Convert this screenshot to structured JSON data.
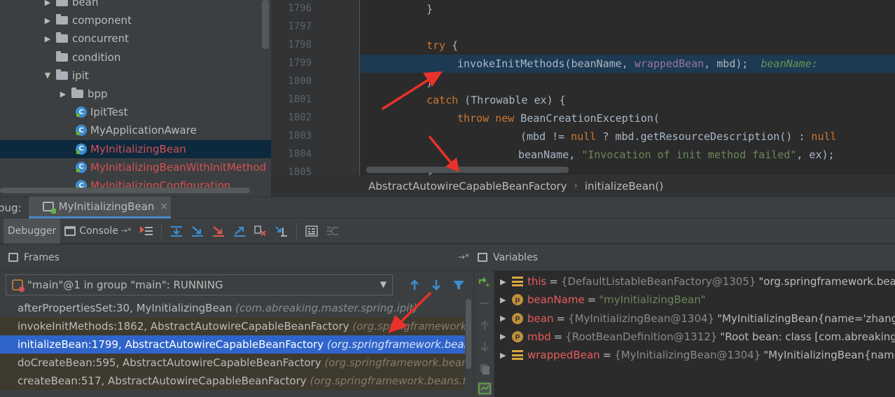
{
  "project_tree": {
    "items": [
      {
        "label": "bean",
        "kind": "folder",
        "arrow": "▶",
        "indent": 66,
        "error": false
      },
      {
        "label": "component",
        "kind": "folder",
        "arrow": "▶",
        "indent": 66,
        "error": false
      },
      {
        "label": "concurrent",
        "kind": "folder",
        "arrow": "▶",
        "indent": 66,
        "error": false
      },
      {
        "label": "condition",
        "kind": "folder",
        "arrow": "",
        "indent": 66,
        "error": false
      },
      {
        "label": "ipit",
        "kind": "folder",
        "arrow": "▼",
        "indent": 66,
        "error": false
      },
      {
        "label": "bpp",
        "kind": "folder",
        "arrow": "▶",
        "indent": 88,
        "error": false
      },
      {
        "label": "IpitTest",
        "kind": "class",
        "arrow": "",
        "indent": 98,
        "error": false
      },
      {
        "label": "MyApplicationAware",
        "kind": "class",
        "arrow": "",
        "indent": 98,
        "error": false
      },
      {
        "label": "MyInitializingBean",
        "kind": "class",
        "arrow": "",
        "indent": 98,
        "error": true,
        "selected": true
      },
      {
        "label": "MyInitializingBeanWithInitMethod",
        "kind": "class",
        "arrow": "",
        "indent": 98,
        "error": true
      },
      {
        "label": "MyInitializingConfiguration",
        "kind": "class",
        "arrow": "",
        "indent": 98,
        "error": true
      }
    ]
  },
  "editor": {
    "line_numbers": [
      "1796",
      "1797",
      "1798",
      "1799",
      "1800",
      "1801",
      "1802",
      "1803",
      "1804",
      "1805"
    ],
    "code": {
      "l1796": "}",
      "l1798_kw": "try",
      "l1798_rest": " {",
      "l1799_call": "invokeInitMethods(beanName, ",
      "l1799_param": "wrappedBean",
      "l1799_rest": ", mbd);",
      "l1799_hint": "beanName: ",
      "l1800": "}",
      "l1801_kw": "catch",
      "l1801_rest": " (Throwable ex) {",
      "l1802_kw1": "throw",
      "l1802_kw2": "new",
      "l1802_rest": " BeanCreationException(",
      "l1803_a": "(mbd != ",
      "l1803_null1": "null",
      "l1803_b": " ? mbd.getResourceDescription() : ",
      "l1803_null2": "null",
      "l1804_a": "beanName, ",
      "l1804_str": "\"Invocation of init method failed\"",
      "l1804_b": ", ex);",
      "l1805": "}"
    }
  },
  "breadcrumb": {
    "class_name": "AbstractAutowireCapableBeanFactory",
    "separator": "›",
    "method": "initializeBean()"
  },
  "debug_panel": {
    "prefix": "bug:",
    "tab_label": "MyInitializingBean",
    "close_glyph": "×"
  },
  "toolbar": {
    "debugger_tab": "Debugger",
    "console_tab": "Console",
    "pin_glyph": "→*"
  },
  "frames": {
    "title": "Frames",
    "pin_glyph": "→*",
    "thread": "\"main\"@1 in group \"main\": RUNNING",
    "dropdown_arrow": "▼",
    "rows": [
      {
        "method": "afterPropertiesSet:30, MyInitializingBean",
        "pkg": "(com.abreaking.master.spring.ipit)",
        "style": "app"
      },
      {
        "method": "invokeInitMethods:1862, AbstractAutowireCapableBeanFactory",
        "pkg": "(org.springframework.be",
        "style": "lib"
      },
      {
        "method": "initializeBean:1799, AbstractAutowireCapableBeanFactory",
        "pkg": "(org.springframework.beans.fa",
        "style": "selected"
      },
      {
        "method": "doCreateBean:595, AbstractAutowireCapableBeanFactory",
        "pkg": "(org.springframework.beans.fa",
        "style": "lib"
      },
      {
        "method": "createBean:517, AbstractAutowireCapableBeanFactory",
        "pkg": "(org.springframework.beans.facto",
        "style": "lib"
      }
    ]
  },
  "variables": {
    "title": "Variables",
    "rows": [
      {
        "icon": "field",
        "name": "this",
        "type": "{DefaultListableBeanFactory@1305}",
        "value": "\"org.springframework.beans.f",
        "is_string": false
      },
      {
        "icon": "param",
        "name": "beanName",
        "type": "",
        "value": "\"myInitializingBean\"",
        "is_string": true
      },
      {
        "icon": "param",
        "name": "bean",
        "type": "{MyInitializingBean@1304}",
        "value": "\"MyInitializingBean{name='zhangsan'",
        "is_string": false
      },
      {
        "icon": "param",
        "name": "mbd",
        "type": "{RootBeanDefinition@1312}",
        "value": "\"Root bean: class [com.abreaking.m",
        "is_string": false
      },
      {
        "icon": "field",
        "name": "wrappedBean",
        "type": "{MyInitializingBean@1304}",
        "value": "\"MyInitializingBean{name='z",
        "is_string": false
      }
    ],
    "param_glyph": "p"
  },
  "colors": {
    "accent": "#4a88c7",
    "selection": "#2f65ca",
    "annotation_arrow": "#e8322a"
  }
}
